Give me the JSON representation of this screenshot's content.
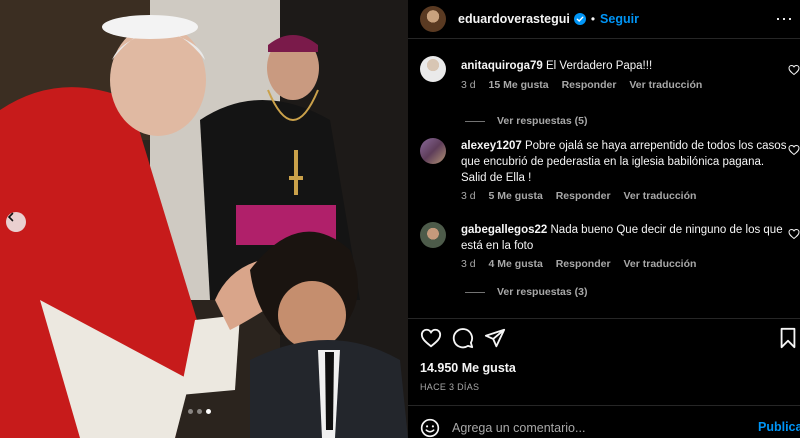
{
  "post": {
    "author": "eduardoverastegui",
    "follow_label": "Seguir",
    "separator": "•",
    "likes": "14.950 Me gusta",
    "date": "HACE 3 DÍAS",
    "add_comment_placeholder": "Agrega un comentario...",
    "publish_label": "Publicar"
  },
  "carousel": {
    "total": 3,
    "current": 3
  },
  "comments": [
    {
      "username": "anitaquiroga79",
      "text": "El Verdadero Papa!!!",
      "time": "3 d",
      "likes": "15 Me gusta",
      "reply": "Responder",
      "translate": "Ver traducción",
      "view_replies": "Ver respuestas (5)"
    },
    {
      "username": "alexey1207",
      "text": "Pobre ojalá se haya arrepentido de todos los casos que encubrió de pederastia en la iglesia babilónica pagana. Salid de Ella !",
      "time": "3 d",
      "likes": "5 Me gusta",
      "reply": "Responder",
      "translate": "Ver traducción"
    },
    {
      "username": "gabegallegos22",
      "text": "Nada bueno Que decir de ninguno de los que está en la foto",
      "time": "3 d",
      "likes": "4 Me gusta",
      "reply": "Responder",
      "translate": "Ver traducción",
      "view_replies": "Ver respuestas (3)"
    }
  ],
  "icons": {
    "more": "more-options-icon",
    "like": "heart-icon",
    "comment": "comment-icon",
    "share": "share-icon",
    "save": "bookmark-icon",
    "emoji": "emoji-icon",
    "verified": "verified-badge-icon",
    "prev": "chevron-left-icon"
  },
  "colors": {
    "accent": "#0095f6",
    "background": "#000000",
    "secondary_text": "#a8a8a8",
    "verified": "#0095f6"
  }
}
